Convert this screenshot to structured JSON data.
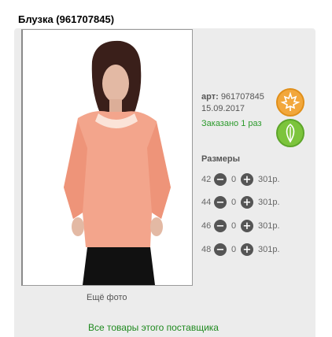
{
  "product": {
    "title": "Блузка (961707845)",
    "article_label": "арт:",
    "article": "961707845",
    "date": "15.09.2017",
    "ordered": "Заказано 1 раз",
    "sizes_title": "Размеры",
    "more_photos": "Ещё фото",
    "supplier_link": "Все товары этого поставщика"
  },
  "sizes": [
    {
      "size": "42",
      "qty": "0",
      "price": "301р."
    },
    {
      "size": "44",
      "qty": "0",
      "price": "301р."
    },
    {
      "size": "46",
      "qty": "0",
      "price": "301р."
    },
    {
      "size": "48",
      "qty": "0",
      "price": "301р."
    }
  ],
  "colors": {
    "orange_badge": "#f2a73b",
    "green_badge": "#7cc43c",
    "ordered_text": "#2c9a2c",
    "link": "#1f8a1f"
  },
  "icons": {
    "orange_badge": "maple-leaf-icon",
    "green_badge": "leaf-icon",
    "minus": "minus-circle-icon",
    "plus": "plus-circle-icon"
  }
}
